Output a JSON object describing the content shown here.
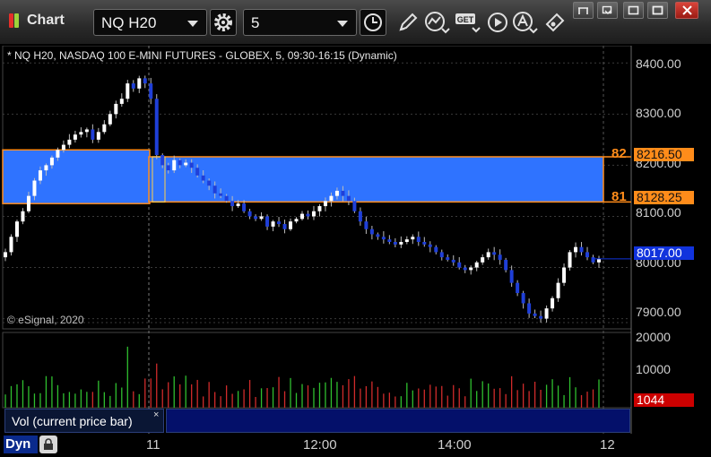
{
  "app": {
    "title": "Chart"
  },
  "toolbar": {
    "symbol": "NQ H20",
    "interval": "5",
    "buttons": [
      "settings-gear-icon",
      "clock-icon",
      "pencil-draw-icon",
      "chart-style-icon",
      "get-data-icon",
      "play-icon",
      "alert-icon",
      "link-icon"
    ],
    "get_button_label": "GET"
  },
  "window_controls": [
    "restore-icon",
    "minimize-icon",
    "maximize-icon",
    "close-icon"
  ],
  "chart": {
    "info_line": "* NQ H20, NASDAQ 100 E-MINI FUTURES - GLOBEX, 5, 09:30-16:15 (Dynamic)",
    "copyright": "© eSignal, 2020",
    "price_axis_labels": [
      "8400.00",
      "8300.00",
      "8200.00",
      "8100.00",
      "8000.00",
      "7900.00"
    ],
    "volume_axis_labels": [
      "20000",
      "10000"
    ],
    "time_axis_labels": [
      "11",
      "12:00",
      "14:00",
      "12"
    ],
    "tags": {
      "upper_level_value": "8216.50",
      "lower_level_value": "8128.25",
      "last_price": "8017.00",
      "volume_value": "1044"
    },
    "level_markers": {
      "upper": "82",
      "lower": "81"
    },
    "volume_legend": "Vol (current price bar)",
    "volume_legend_close": "×",
    "bottom_left_label": "Dyn",
    "colors": {
      "background": "#000000",
      "zone_fill": "#2f73ff",
      "zone_border": "#ff8c1a",
      "up_candle": "#ffffff",
      "down_candle": "#1f3fd8",
      "vol_up": "#2fbf2f",
      "vol_down": "#d12b2b",
      "last_price_tag": "#1133dd",
      "volume_tag": "#cc0000"
    }
  },
  "chart_data": {
    "type": "candlestick",
    "title": "NQ H20, NASDAQ 100 E-MINI FUTURES - GLOBEX, 5, 09:30-16:15 (Dynamic)",
    "ylim": [
      7880,
      8425
    ],
    "zones": [
      {
        "from": 8128.25,
        "to": 8216.5,
        "segment": "current"
      },
      {
        "from": 8125,
        "to": 8230,
        "segment": "prior"
      }
    ],
    "closes": [
      8030,
      8060,
      8090,
      8110,
      8140,
      8170,
      8190,
      8200,
      8215,
      8230,
      8240,
      8250,
      8260,
      8265,
      8270,
      8250,
      8265,
      8280,
      8300,
      8320,
      8330,
      8360,
      8350,
      8370,
      8360,
      8330,
      8220,
      8200,
      8190,
      8210,
      8200,
      8205,
      8195,
      8180,
      8170,
      8160,
      8145,
      8140,
      8130,
      8120,
      8125,
      8110,
      8100,
      8095,
      8100,
      8080,
      8090,
      8085,
      8075,
      8090,
      8095,
      8105,
      8100,
      8110,
      8120,
      8130,
      8140,
      8150,
      8140,
      8130,
      8110,
      8090,
      8075,
      8065,
      8060,
      8055,
      8050,
      8045,
      8050,
      8055,
      8060,
      8050,
      8045,
      8040,
      8030,
      8020,
      8015,
      8010,
      8000,
      7995,
      8000,
      8010,
      8020,
      8030,
      8025,
      8015,
      7995,
      7970,
      7950,
      7930,
      7910,
      7905,
      7900,
      7920,
      7940,
      7970,
      8000,
      8030,
      8040,
      8030,
      8020,
      8010,
      8017
    ]
  }
}
